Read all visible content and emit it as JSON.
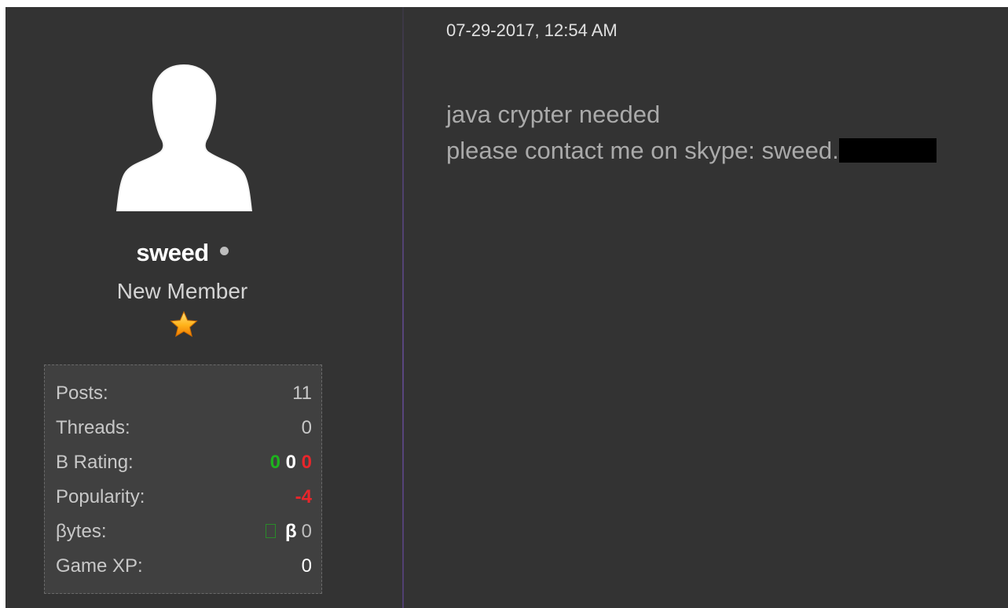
{
  "post": {
    "timestamp": "07-29-2017, 12:54 AM",
    "lines": [
      "java crypter needed",
      "please contact me on skype: sweed."
    ]
  },
  "user": {
    "username": "sweed",
    "title": "New Member",
    "status": "offline",
    "rank_icon": "star-icon"
  },
  "stats": {
    "posts": {
      "label": "Posts:",
      "value": "11"
    },
    "threads": {
      "label": "Threads:",
      "value": "0"
    },
    "b_rating": {
      "label": "B Rating:",
      "positive": "0",
      "neutral": "0",
      "negative": "0"
    },
    "popularity": {
      "label": "Popularity:",
      "value": "-4"
    },
    "bytes": {
      "label": "βytes:",
      "symbol": "β",
      "value": "0"
    },
    "game_xp": {
      "label": "Game XP:",
      "value": "0"
    }
  },
  "colors": {
    "background": "#333333",
    "stats_box": "#404040",
    "positive": "#1db31d",
    "negative": "#e8262b",
    "divider": "#5a4680"
  }
}
